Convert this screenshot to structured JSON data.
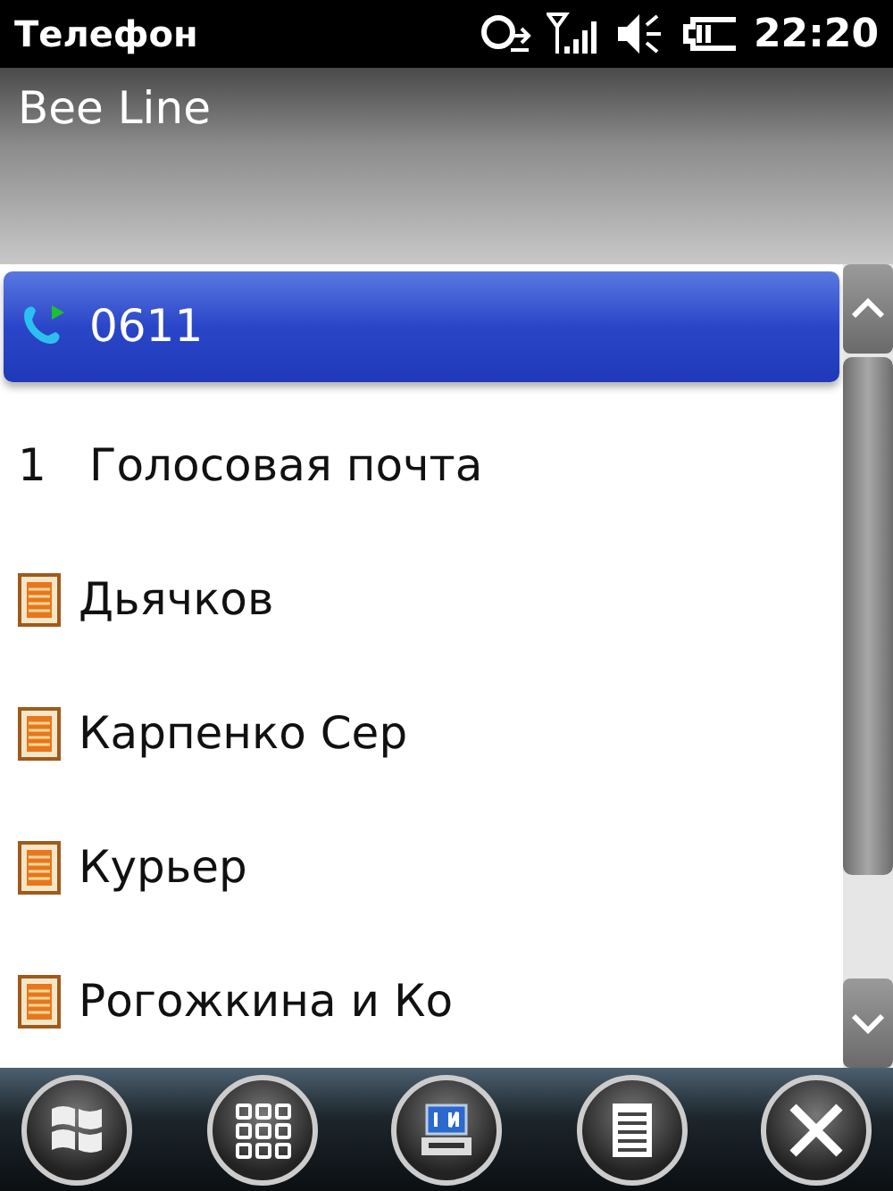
{
  "status_bar": {
    "title": "Телефон",
    "time": "22:20"
  },
  "header": {
    "operator": "Bee Line"
  },
  "entries": [
    {
      "kind": "call",
      "label": "0611",
      "selected": true
    },
    {
      "kind": "speeddial",
      "key": "1",
      "label": "Голосовая почта",
      "selected": false
    },
    {
      "kind": "contact",
      "label": "Дьячков",
      "selected": false
    },
    {
      "kind": "contact",
      "label": "Карпенко Сер",
      "selected": false
    },
    {
      "kind": "contact",
      "label": "Курьер",
      "selected": false
    },
    {
      "kind": "contact",
      "label": "Рогожкина и Ко",
      "selected": false
    }
  ],
  "softkeys": [
    {
      "kind": "start"
    },
    {
      "kind": "apps"
    },
    {
      "kind": "keyboard"
    },
    {
      "kind": "menu"
    },
    {
      "kind": "close"
    }
  ]
}
